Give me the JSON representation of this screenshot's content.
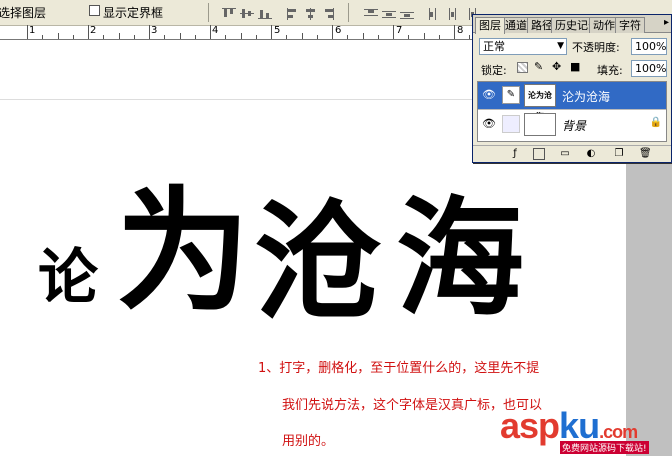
{
  "options_bar": {
    "auto_select_label": "选择图层",
    "show_bounds_label": "显示定界框",
    "align_icons": [
      "align-top-icon",
      "align-vcenter-icon",
      "align-bottom-icon",
      "align-left-icon",
      "align-hcenter-icon",
      "align-right-icon",
      "distribute-top-icon",
      "distribute-vcenter-icon",
      "distribute-bottom-icon",
      "distribute-left-icon",
      "distribute-hcenter-icon",
      "distribute-right-icon"
    ]
  },
  "ruler": {
    "labels": [
      "1",
      "2",
      "3",
      "4",
      "5",
      "6",
      "7",
      "8"
    ]
  },
  "artwork": {
    "chars": [
      "论",
      "为",
      "沧",
      "海"
    ]
  },
  "note": {
    "line1": "1、打字，删格化，至于位置什么的，这里先不提",
    "line2": "我们先说方法，这个字体是汉真广标，也可以",
    "line3": "用别的。"
  },
  "watermark": {
    "asp": "asp",
    "ku": "ku",
    "tld": ".com",
    "tagline": "免费网站源码下载站!"
  },
  "layers_panel": {
    "tabs": [
      "图层",
      "通道",
      "路径",
      "历史记录",
      "动作",
      "字符"
    ],
    "blend_mode": "正常",
    "opacity_label": "不透明度:",
    "opacity_value": "100%",
    "lock_label": "锁定:",
    "fill_label": "填充:",
    "fill_value": "100%",
    "layers": [
      {
        "name": "沦为沧海",
        "thumb": "沦为沧海",
        "selected": true
      },
      {
        "name": "背景",
        "thumb": "",
        "selected": false
      }
    ]
  },
  "colors": {
    "accent_selected": "#316ac5",
    "note_red": "#d01010",
    "watermark_red": "#e23b2f",
    "watermark_blue": "#1f6fd1"
  }
}
